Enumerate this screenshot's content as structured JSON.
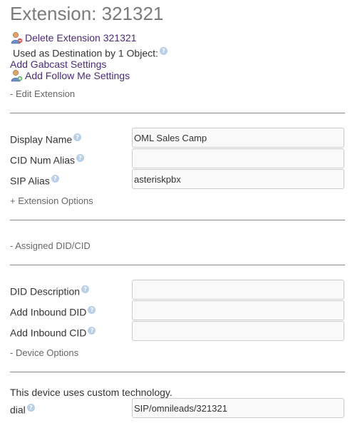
{
  "title": "Extension: 321321",
  "actions": {
    "delete_extension": "Delete Extension 321321",
    "used_as_destination": "Used as Destination by 1 Object:",
    "add_gabcast": "Add Gabcast Settings",
    "add_follow_me": "Add Follow Me Settings"
  },
  "sections": {
    "edit_extension": "- Edit Extension",
    "extension_options": "+ Extension Options",
    "assigned_did": "- Assigned DID/CID",
    "device_options": "- Device Options"
  },
  "fields": {
    "display_name": {
      "label": "Display Name",
      "value": "OML Sales Camp"
    },
    "cid_num_alias": {
      "label": "CID Num Alias",
      "value": ""
    },
    "sip_alias": {
      "label": "SIP Alias",
      "value": "asteriskpbx"
    },
    "did_description": {
      "label": "DID Description",
      "value": ""
    },
    "add_inbound_did": {
      "label": "Add Inbound DID",
      "value": ""
    },
    "add_inbound_cid": {
      "label": "Add Inbound CID",
      "value": ""
    },
    "dial": {
      "label": "dial",
      "value": "SIP/omnileads/321321"
    }
  },
  "device": {
    "custom_tech_note": "This device uses custom technology."
  },
  "help_icon_glyph": "?",
  "icons": {
    "user": "user-icon",
    "help": "help-icon"
  },
  "colors": {
    "title": "#7a7a7a",
    "link": "#4b2a7a",
    "section_toggle": "#666666",
    "help_icon": "#b8cfe8",
    "divider": "#888888",
    "input_border": "#cccccc"
  }
}
